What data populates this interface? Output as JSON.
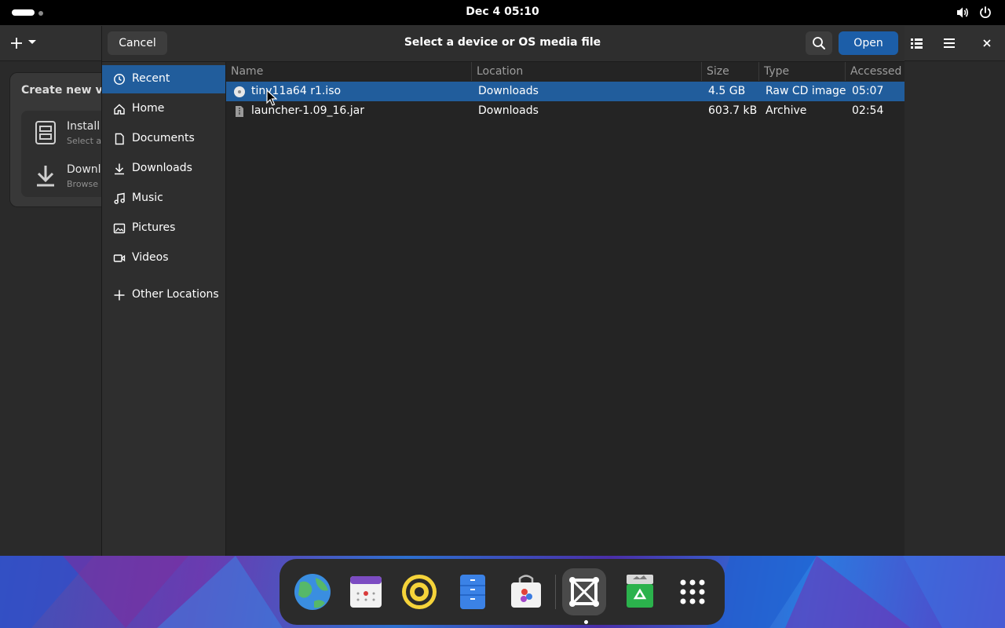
{
  "topbar": {
    "clock": "Dec 4  05:10"
  },
  "background_window": {
    "popover_title": "Create new virt",
    "items": [
      {
        "title": "Install",
        "subtitle": "Select a"
      },
      {
        "title": "Downl",
        "subtitle": "Browse"
      }
    ]
  },
  "dialog": {
    "title": "Select a device or OS media file",
    "cancel_label": "Cancel",
    "open_label": "Open"
  },
  "sidebar": {
    "items": [
      {
        "label": "Recent",
        "icon": "clock-icon",
        "active": true
      },
      {
        "label": "Home",
        "icon": "home-icon",
        "active": false
      },
      {
        "label": "Documents",
        "icon": "document-icon",
        "active": false
      },
      {
        "label": "Downloads",
        "icon": "download-icon",
        "active": false
      },
      {
        "label": "Music",
        "icon": "music-icon",
        "active": false
      },
      {
        "label": "Pictures",
        "icon": "picture-icon",
        "active": false
      },
      {
        "label": "Videos",
        "icon": "video-icon",
        "active": false
      },
      {
        "label": "Other Locations",
        "icon": "plus-icon",
        "active": false
      }
    ]
  },
  "filelist": {
    "columns": [
      "Name",
      "Location",
      "Size",
      "Type",
      "Accessed"
    ],
    "rows": [
      {
        "name": "tiny11a64 r1.iso",
        "location": "Downloads",
        "size": "4.5 GB",
        "type": "Raw CD image",
        "accessed": "05:07",
        "icon": "disc-icon",
        "selected": true
      },
      {
        "name": "launcher-1.09_16.jar",
        "location": "Downloads",
        "size": "603.7 kB",
        "type": "Archive",
        "accessed": "02:54",
        "icon": "archive-file-icon",
        "selected": false
      }
    ]
  },
  "dock": {
    "apps": [
      "globe-icon",
      "calendar-icon",
      "speaker-icon",
      "file-cabinet-icon",
      "software-bag-icon",
      "boxes-icon",
      "recycle-icon",
      "app-grid-icon"
    ],
    "accent": "#215d9c"
  }
}
